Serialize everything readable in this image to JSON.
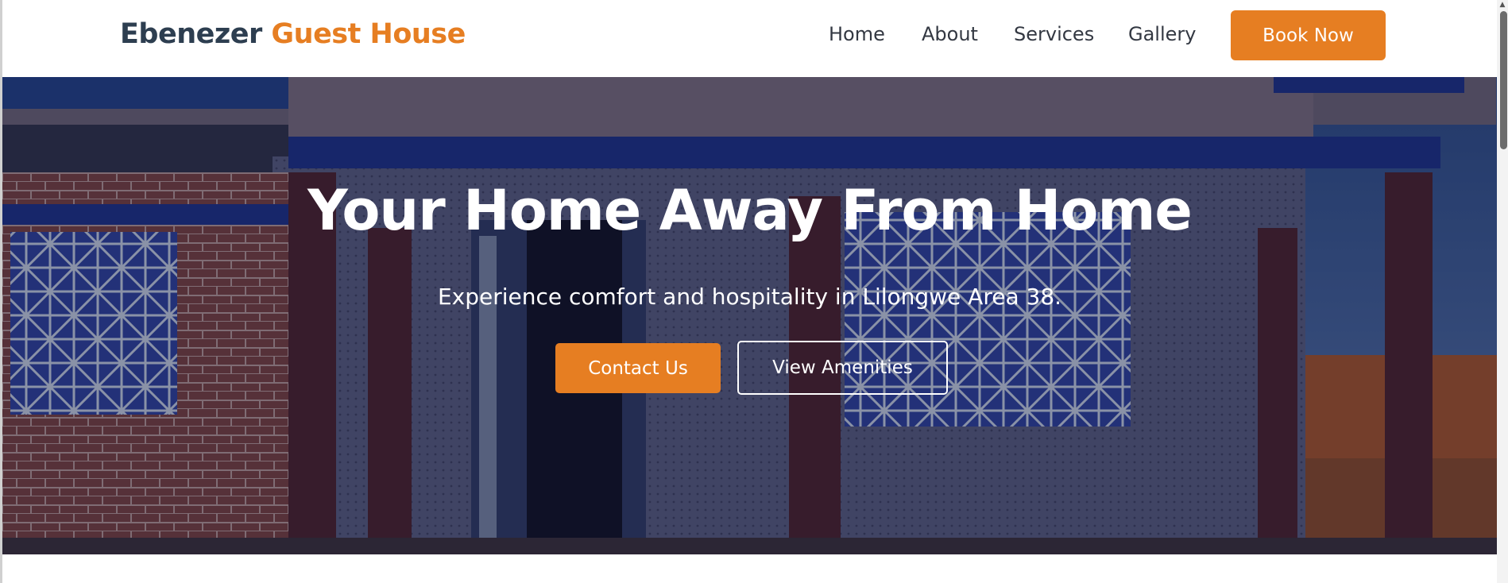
{
  "header": {
    "logo_part1": "Ebenezer",
    "logo_part2": "Guest House",
    "nav": {
      "home": "Home",
      "about": "About",
      "services": "Services",
      "gallery": "Gallery"
    },
    "book_now": "Book Now"
  },
  "hero": {
    "title": "Your Home Away From Home",
    "subtitle": "Experience comfort and hospitality in Lilongwe Area 38.",
    "contact_button": "Contact Us",
    "amenities_button": "View Amenities"
  },
  "colors": {
    "accent": "#e67e22",
    "brand_dark": "#2d3e50",
    "nav_text": "#333842",
    "hero_text": "#ffffff"
  },
  "icons": {
    "scroll_up": "chevron-up-icon"
  }
}
